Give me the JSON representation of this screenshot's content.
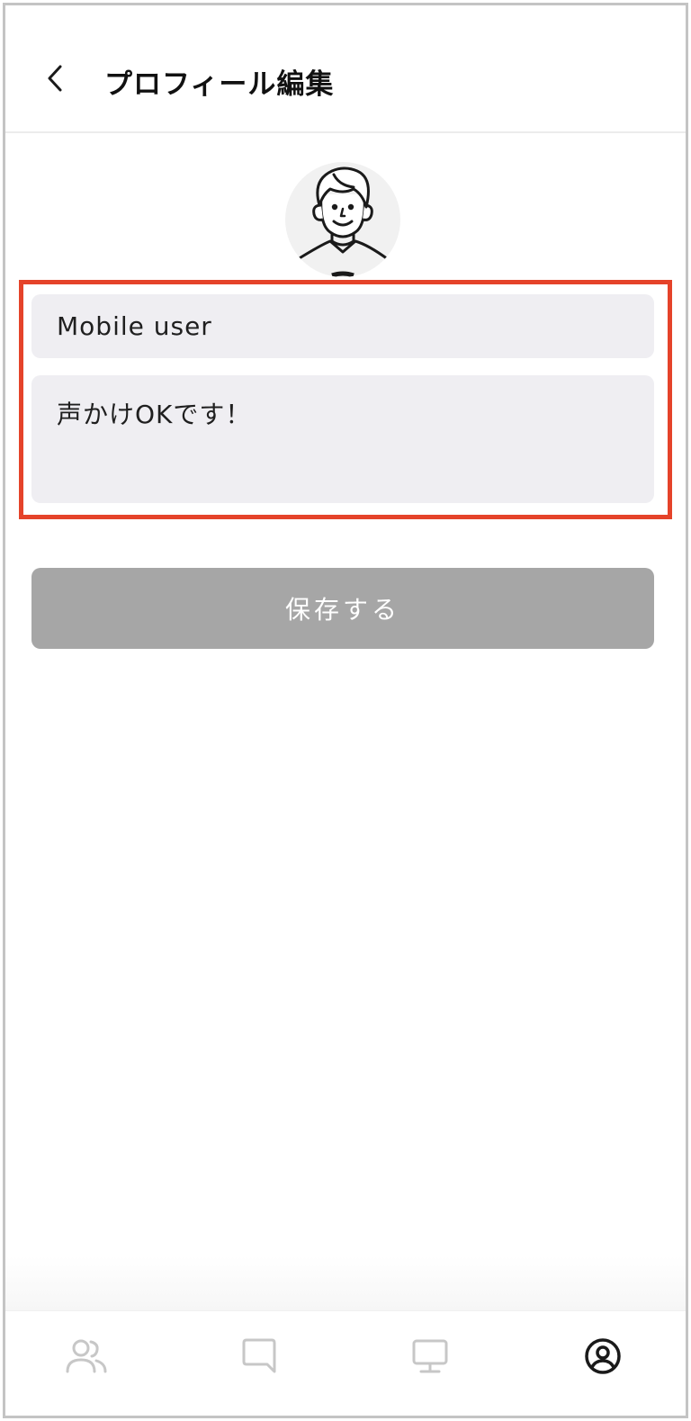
{
  "header": {
    "title": "プロフィール編集",
    "back_icon": "chevron-left-icon"
  },
  "avatar": {
    "icon": "user-avatar-illustration"
  },
  "form": {
    "name_value": "Mobile user",
    "bio_value": "声かけOKです！"
  },
  "save_button": {
    "label": "保存する"
  },
  "colors": {
    "highlight": "#e5432a",
    "field_bg": "#efeef2",
    "button_disabled": "#a6a6a6",
    "nav_inactive": "#c7c7c7",
    "nav_active": "#1a1a1a"
  },
  "bottom_nav": {
    "items": [
      {
        "icon": "people-icon",
        "active": false
      },
      {
        "icon": "chat-icon",
        "active": false
      },
      {
        "icon": "monitor-icon",
        "active": false
      },
      {
        "icon": "profile-icon",
        "active": true
      }
    ]
  }
}
